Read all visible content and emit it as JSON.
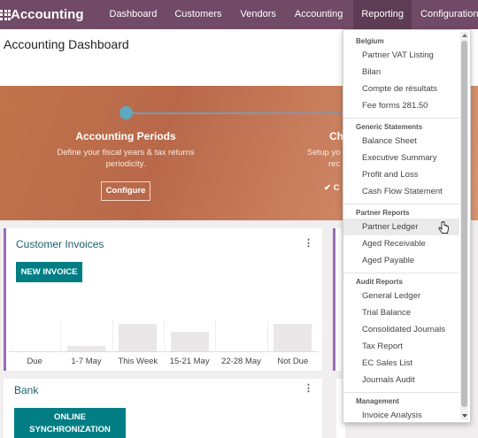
{
  "navbar": {
    "brand": "Accounting",
    "items": [
      {
        "label": "Dashboard"
      },
      {
        "label": "Customers"
      },
      {
        "label": "Vendors"
      },
      {
        "label": "Accounting"
      },
      {
        "label": "Reporting"
      },
      {
        "label": "Configuration"
      }
    ]
  },
  "page": {
    "title": "Accounting Dashboard"
  },
  "banner": {
    "step1": {
      "title": "Accounting Periods",
      "description_line1": "Define your fiscal years & tax returns",
      "description_line2": "periodicity.",
      "button": "Configure"
    },
    "step2": {
      "title_partial": "Ch",
      "description_partial_line1": "Setup yo",
      "description_partial_line2": "rec",
      "check_partial": "✔ C"
    }
  },
  "invoices": {
    "title": "Customer Invoices",
    "new_button": "NEW INVOICE",
    "menu_icon": "⋮",
    "chart_data": {
      "type": "bar",
      "categories": [
        "Due",
        "1-7 May",
        "This Week",
        "15-21 May",
        "22-28 May",
        "Not Due"
      ],
      "series": [
        {
          "values": [
            0,
            0.2,
            1,
            0.7,
            0,
            1
          ]
        }
      ]
    }
  },
  "bank": {
    "title": "Bank",
    "menu_icon": "⋮",
    "sync_line1": "ONLINE",
    "sync_line2": "SYNCHRONIZATION"
  },
  "right_sliver_text": "o",
  "dropdown": {
    "sections": [
      {
        "header": "Belgium",
        "items": [
          "Partner VAT Listing",
          "Bilan",
          "Compte de résultats",
          "Fee forms 281.50"
        ]
      },
      {
        "header": "Generic Statements",
        "items": [
          "Balance Sheet",
          "Executive Summary",
          "Profit and Loss",
          "Cash Flow Statement"
        ]
      },
      {
        "header": "Partner Reports",
        "items": [
          "Partner Ledger",
          "Aged Receivable",
          "Aged Payable"
        ]
      },
      {
        "header": "Audit Reports",
        "items": [
          "General Ledger",
          "Trial Balance",
          "Consolidated Journals",
          "Tax Report",
          "EC Sales List",
          "Journals Audit"
        ]
      },
      {
        "header": "Management",
        "items": [
          "Invoice Analysis"
        ]
      }
    ],
    "hovered_item": "Partner Ledger"
  },
  "colors": {
    "navbar": "#704a66",
    "navbar_active": "#5e3c55",
    "primary_button": "#017e84",
    "card_title": "#1a5f6a",
    "card_accent": "#9a6eb5"
  }
}
